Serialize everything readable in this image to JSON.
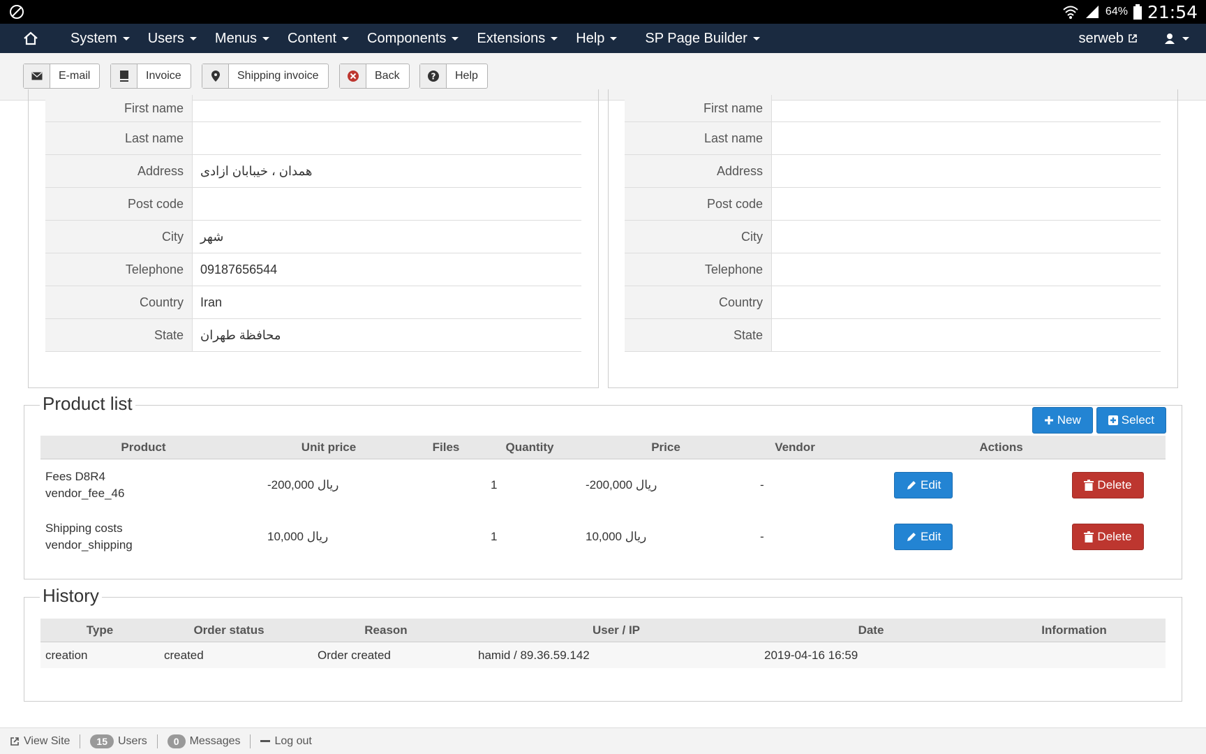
{
  "status_bar": {
    "battery": "64%",
    "time": "21:54"
  },
  "navbar": {
    "menus": [
      "System",
      "Users",
      "Menus",
      "Content",
      "Components",
      "Extensions",
      "Help",
      "SP Page Builder"
    ],
    "site_name": "serweb"
  },
  "toolbar": {
    "buttons": [
      {
        "label": "E-mail",
        "icon": "envelope-icon"
      },
      {
        "label": "Invoice",
        "icon": "book-icon"
      },
      {
        "label": "Shipping invoice",
        "icon": "map-pin-icon"
      },
      {
        "label": "Back",
        "icon": "cancel-circle-icon"
      },
      {
        "label": "Help",
        "icon": "question-circle-icon"
      }
    ]
  },
  "billing_address": {
    "labels": [
      "First name",
      "Last name",
      "Address",
      "Post code",
      "City",
      "Telephone",
      "Country",
      "State"
    ],
    "values": [
      "",
      "",
      "همدان ، خیبابان ازادی",
      "",
      "شهر",
      "09187656544",
      "Iran",
      "محافظة طهران"
    ]
  },
  "shipping_address": {
    "labels": [
      "First name",
      "Last name",
      "Address",
      "Post code",
      "City",
      "Telephone",
      "Country",
      "State"
    ],
    "values": [
      "",
      "",
      "",
      "",
      "",
      "",
      "",
      ""
    ]
  },
  "product_list": {
    "title": "Product list",
    "new_label": "New",
    "select_label": "Select",
    "columns": [
      "Product",
      "Unit price",
      "Files",
      "Quantity",
      "Price",
      "Vendor",
      "Actions"
    ],
    "rows": [
      {
        "name": "Fees D8R4",
        "sku": "vendor_fee_46",
        "unit_price": "-200,000 ریال",
        "files": "",
        "quantity": "1",
        "price": "-200,000 ریال",
        "vendor": "-",
        "edit": "Edit",
        "delete": "Delete"
      },
      {
        "name": "Shipping costs",
        "sku": "vendor_shipping",
        "unit_price": "10,000 ریال",
        "files": "",
        "quantity": "1",
        "price": "10,000 ریال",
        "vendor": "-",
        "edit": "Edit",
        "delete": "Delete"
      }
    ]
  },
  "history": {
    "title": "History",
    "columns": [
      "Type",
      "Order status",
      "Reason",
      "User / IP",
      "Date",
      "Information"
    ],
    "rows": [
      {
        "type": "creation",
        "status": "created",
        "reason": "Order created",
        "user_ip": "hamid / 89.36.59.142",
        "date": "2019-04-16 16:59",
        "info": ""
      }
    ]
  },
  "footer": {
    "view_site": "View Site",
    "users_count": "15",
    "users_label": "Users",
    "messages_count": "0",
    "messages_label": "Messages",
    "logout": "Log out"
  }
}
